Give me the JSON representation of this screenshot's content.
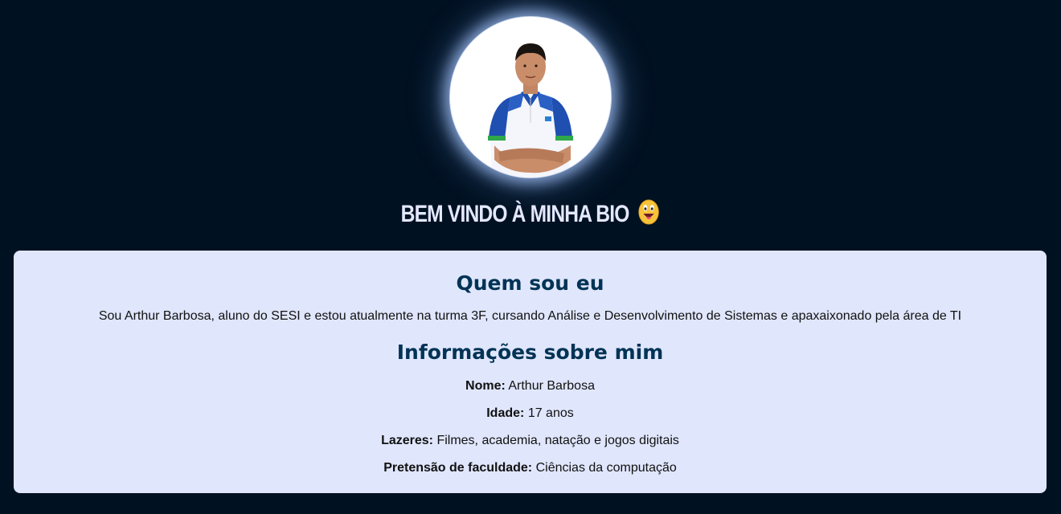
{
  "header": {
    "welcome_title": "BEM VINDO À MINHA BIO",
    "emoji_icon": "grinning-tongue-emoji",
    "avatar_alt": "Foto de perfil"
  },
  "about": {
    "heading": "Quem sou eu",
    "text": "Sou Arthur Barbosa, aluno do SESI e estou atualmente na turma 3F, cursando Análise e Desenvolvimento de Sistemas e apaxaixonado pela área de TI"
  },
  "info": {
    "heading": "Informações sobre mim",
    "items": [
      {
        "label": "Nome:",
        "value": "Arthur Barbosa"
      },
      {
        "label": "Idade:",
        "value": "17 anos"
      },
      {
        "label": "Lazeres:",
        "value": "Filmes, academia, natação e jogos digitais"
      },
      {
        "label": "Pretensão de faculdade:",
        "value": "Ciências da computação"
      }
    ]
  },
  "colors": {
    "background": "#001122",
    "card": "#e0e6fc",
    "heading": "#003355",
    "welcome_text": "#e4e8ff"
  }
}
